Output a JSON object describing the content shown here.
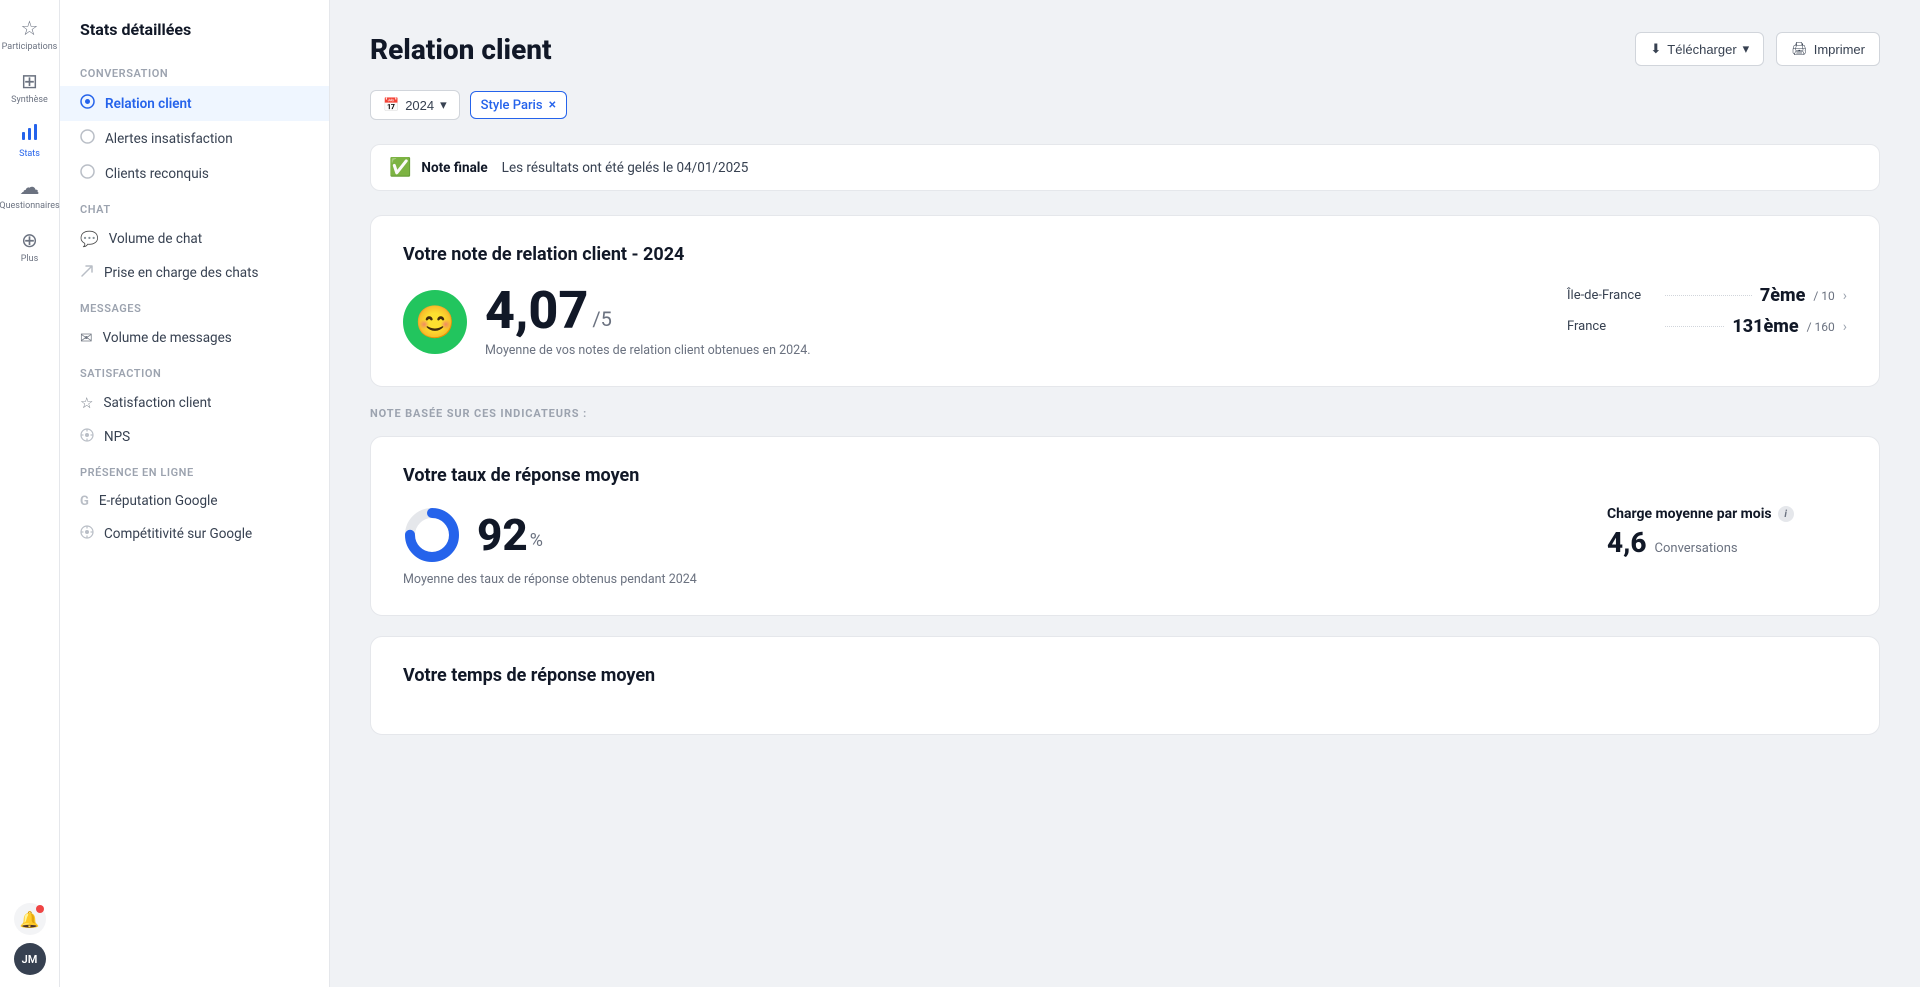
{
  "iconBar": {
    "items": [
      {
        "id": "participations",
        "label": "Participations",
        "icon": "☆",
        "active": false
      },
      {
        "id": "synthese",
        "label": "Synthèse",
        "icon": "⊞",
        "active": false
      },
      {
        "id": "stats",
        "label": "Stats",
        "icon": "📊",
        "active": true
      },
      {
        "id": "questionnaires",
        "label": "Questionnaires",
        "icon": "☁",
        "active": false
      },
      {
        "id": "plus",
        "label": "Plus",
        "icon": "⊕",
        "active": false
      }
    ],
    "avatar": "JM",
    "notificationIcon": "🔔"
  },
  "sidebar": {
    "title": "Stats détaillées",
    "sections": [
      {
        "label": "Conversation",
        "items": [
          {
            "id": "relation-client",
            "label": "Relation client",
            "icon": "●",
            "active": true
          },
          {
            "id": "alertes",
            "label": "Alertes insatisfaction",
            "icon": "○",
            "active": false
          },
          {
            "id": "clients",
            "label": "Clients reconquis",
            "icon": "○",
            "active": false
          }
        ]
      },
      {
        "label": "Chat",
        "items": [
          {
            "id": "volume-chat",
            "label": "Volume de chat",
            "icon": "💬",
            "active": false
          },
          {
            "id": "prise-charge",
            "label": "Prise en charge des chats",
            "icon": "↗",
            "active": false
          }
        ]
      },
      {
        "label": "Messages",
        "items": [
          {
            "id": "volume-messages",
            "label": "Volume de messages",
            "icon": "✉",
            "active": false
          }
        ]
      },
      {
        "label": "Satisfaction",
        "items": [
          {
            "id": "satisfaction-client",
            "label": "Satisfaction client",
            "icon": "☆",
            "active": false
          },
          {
            "id": "nps",
            "label": "NPS",
            "icon": "⊕",
            "active": false
          }
        ]
      },
      {
        "label": "Présence en ligne",
        "items": [
          {
            "id": "e-reputation",
            "label": "E-réputation Google",
            "icon": "G",
            "active": false
          },
          {
            "id": "competitivite",
            "label": "Compétitivité sur Google",
            "icon": "⊕",
            "active": false
          }
        ]
      }
    ]
  },
  "main": {
    "pageTitle": "Relation client",
    "actions": {
      "download": "Télécharger",
      "print": "Imprimer"
    },
    "filters": {
      "year": "2024",
      "yearIcon": "📅",
      "tag": "Style Paris",
      "tagClose": "×"
    },
    "noteBar": {
      "icon": "✓",
      "label": "Note finale",
      "text": "Les résultats ont été gelés le 04/01/2025"
    },
    "scoreCard": {
      "title": "Votre note de relation client - 2024",
      "emoji": "😊",
      "score": "4,07",
      "denom": "/5",
      "sub": "Moyenne de vos notes de relation client obtenues en 2024.",
      "rankings": [
        {
          "label": "Île-de-France",
          "rank": "7ème",
          "total": "/ 10",
          "hasArrow": true
        },
        {
          "label": "France",
          "rank": "131ème",
          "total": "/ 160",
          "hasArrow": true
        }
      ]
    },
    "sectionLabel": "NOTE BASÉE SUR CES INDICATEURS :",
    "responseCard": {
      "title": "Votre taux de réponse moyen",
      "percent": "92",
      "percentUnit": "%",
      "sub": "Moyenne des taux de réponse obtenus pendant 2024",
      "donutFill": 0.92,
      "chargeLabel": "Charge moyenne par mois",
      "chargeValue": "4,6",
      "chargeUnit": "Conversations"
    },
    "responseTimeCard": {
      "title": "Votre temps de réponse moyen"
    }
  }
}
